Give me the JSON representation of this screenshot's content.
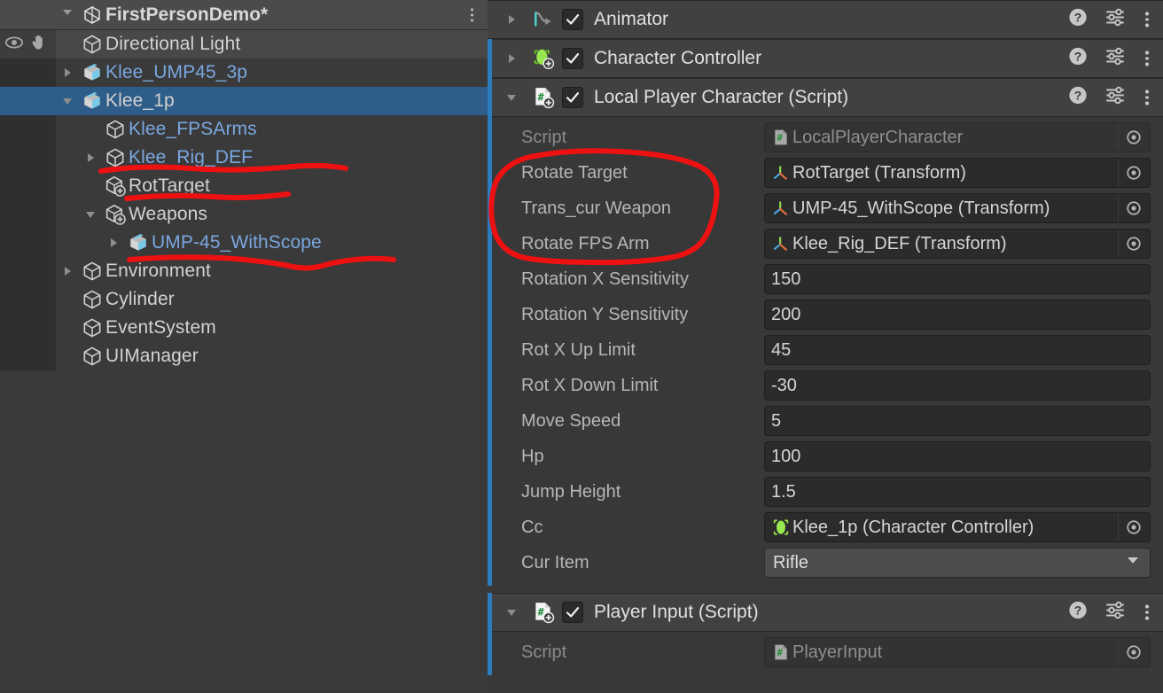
{
  "app": "Unity Editor",
  "hierarchy": {
    "scene_title": "FirstPersonDemo*",
    "scene_icon": "unity-logo-icon",
    "kebab_label": "⋮",
    "rows": [
      {
        "label": "Directional Light",
        "indent": 1,
        "twisty": "none",
        "icon": "gameobject-icon",
        "style": "normal",
        "state": "hover",
        "gutter_icons": true
      },
      {
        "label": "Klee_UMP45_3p",
        "indent": 1,
        "twisty": "collapsed",
        "icon": "prefab-icon",
        "style": "prefab",
        "state": "normal",
        "gutter_icons": false
      },
      {
        "label": "Klee_1p",
        "indent": 1,
        "twisty": "expanded",
        "icon": "prefab-icon",
        "style": "normal",
        "state": "selected",
        "gutter_icons": false
      },
      {
        "label": "Klee_FPSArms",
        "indent": 2,
        "twisty": "none",
        "icon": "gameobject-icon",
        "style": "prefab",
        "state": "normal",
        "gutter_icons": false
      },
      {
        "label": "Klee_Rig_DEF",
        "indent": 2,
        "twisty": "collapsed",
        "icon": "gameobject-icon",
        "style": "prefab",
        "state": "normal",
        "gutter_icons": false
      },
      {
        "label": "RotTarget",
        "indent": 2,
        "twisty": "none",
        "icon": "gameobject-plus-icon",
        "style": "normal",
        "state": "normal",
        "gutter_icons": false
      },
      {
        "label": "Weapons",
        "indent": 2,
        "twisty": "expanded",
        "icon": "gameobject-plus-icon",
        "style": "normal",
        "state": "normal",
        "gutter_icons": false
      },
      {
        "label": "UMP-45_WithScope",
        "indent": 3,
        "twisty": "collapsed",
        "icon": "prefab-icon",
        "style": "prefab",
        "state": "normal",
        "gutter_icons": false
      },
      {
        "label": "Environment",
        "indent": 1,
        "twisty": "collapsed",
        "icon": "gameobject-icon",
        "style": "normal",
        "state": "normal",
        "gutter_icons": false
      },
      {
        "label": "Cylinder",
        "indent": 1,
        "twisty": "none",
        "icon": "gameobject-icon",
        "style": "normal",
        "state": "normal",
        "gutter_icons": false
      },
      {
        "label": "EventSystem",
        "indent": 1,
        "twisty": "none",
        "icon": "gameobject-icon",
        "style": "normal",
        "state": "normal",
        "gutter_icons": false
      },
      {
        "label": "UIManager",
        "indent": 1,
        "twisty": "none",
        "icon": "gameobject-icon",
        "style": "normal",
        "state": "normal",
        "gutter_icons": false
      }
    ]
  },
  "inspector": {
    "components": [
      {
        "title": "Animator",
        "icon": "animator-icon",
        "enabled": true,
        "foldout": "collapsed",
        "accent": false,
        "properties": []
      },
      {
        "title": "Character Controller",
        "icon": "character-controller-icon",
        "enabled": true,
        "foldout": "collapsed",
        "accent": true,
        "properties": []
      },
      {
        "title": "Local Player Character (Script)",
        "icon": "cs-script-icon",
        "enabled": true,
        "foldout": "expanded",
        "accent": true,
        "properties": [
          {
            "label": "Script",
            "value": "LocalPlayerCharacter",
            "kind": "object-readonly",
            "icon": "cs-script-small-icon"
          },
          {
            "label": "Rotate Target",
            "value": "RotTarget (Transform)",
            "kind": "object",
            "icon": "transform-icon"
          },
          {
            "label": "Trans_cur Weapon",
            "value": "UMP-45_WithScope (Transform)",
            "kind": "object",
            "icon": "transform-icon"
          },
          {
            "label": "Rotate FPS Arm",
            "value": "Klee_Rig_DEF (Transform)",
            "kind": "object",
            "icon": "transform-icon"
          },
          {
            "label": "Rotation X Sensitivity",
            "value": "150",
            "kind": "text",
            "icon": ""
          },
          {
            "label": "Rotation Y Sensitivity",
            "value": "200",
            "kind": "text",
            "icon": ""
          },
          {
            "label": "Rot X Up Limit",
            "value": "45",
            "kind": "text",
            "icon": ""
          },
          {
            "label": "Rot X Down Limit",
            "value": "-30",
            "kind": "text",
            "icon": ""
          },
          {
            "label": "Move Speed",
            "value": "5",
            "kind": "text",
            "icon": ""
          },
          {
            "label": "Hp",
            "value": "100",
            "kind": "text",
            "icon": ""
          },
          {
            "label": "Jump Height",
            "value": "1.5",
            "kind": "text",
            "icon": ""
          },
          {
            "label": "Cc",
            "value": "Klee_1p (Character Controller)",
            "kind": "object",
            "icon": "character-controller-small-icon"
          },
          {
            "label": "Cur Item",
            "value": "Rifle",
            "kind": "dropdown",
            "icon": ""
          }
        ]
      },
      {
        "title": "Player Input (Script)",
        "icon": "cs-script-icon",
        "enabled": true,
        "foldout": "expanded",
        "accent": true,
        "properties": [
          {
            "label": "Script",
            "value": "PlayerInput",
            "kind": "object-readonly",
            "icon": "cs-script-small-icon"
          }
        ]
      }
    ],
    "tools": {
      "help": "help-icon",
      "preset": "preset-icon",
      "menu": "kebab-menu-icon"
    }
  },
  "annotations": {
    "color": "#ee1111",
    "marks": [
      {
        "name": "underline-klee-rig-def",
        "type": "underline"
      },
      {
        "name": "underline-rottarget",
        "type": "underline"
      },
      {
        "name": "underline-ump45-scope",
        "type": "underline"
      },
      {
        "name": "circle-transform-fields",
        "type": "ellipse"
      }
    ]
  },
  "colors": {
    "hierarchy_bg": "#3a3a3a",
    "inspector_bg": "#383838",
    "selection_blue": "#2d5d88",
    "prefab_blue": "#7aa7e0",
    "accent_blue": "#2b7bbd",
    "annotation_red": "#ee1111"
  }
}
